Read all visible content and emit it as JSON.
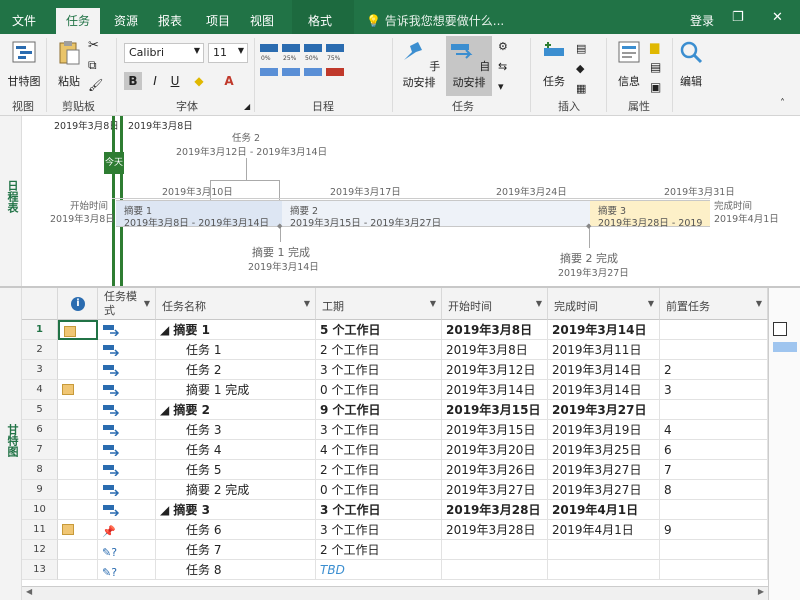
{
  "menu": {
    "tabs": [
      {
        "label": "文件"
      },
      {
        "label": "任务"
      },
      {
        "label": "资源"
      },
      {
        "label": "报表"
      },
      {
        "label": "项目"
      },
      {
        "label": "视图"
      },
      {
        "label": "格式"
      }
    ],
    "tell_me": "告诉我您想要做什么...",
    "login": "登录"
  },
  "ribbon": {
    "view": {
      "gantt_label": "甘特图",
      "group": "视图"
    },
    "clipboard": {
      "paste_label": "粘贴",
      "group": "剪贴板"
    },
    "font": {
      "name": "Calibri",
      "size": "11",
      "bold": "B",
      "italic": "I",
      "underline": "U",
      "group": "字体"
    },
    "schedule": {
      "group": "日程"
    },
    "tasks": {
      "manual_label": "手动安排",
      "auto_label": "自动安排",
      "task_label": "任务",
      "group": "任务"
    },
    "insert": {
      "group": "插入"
    },
    "properties": {
      "info_label": "信息",
      "group": "属性"
    },
    "editing": {
      "label": "编辑"
    }
  },
  "timeline": {
    "side_label": "日程表",
    "today_top_left": "2019年3月8日",
    "today_top_right": "2019年3月8日",
    "today_label": "今天",
    "task2_label": "任务 2",
    "task2_dates": "2019年3月12日 - 2019年3月14日",
    "scale": [
      "2019年3月10日",
      "2019年3月17日",
      "2019年3月24日",
      "2019年3月31日"
    ],
    "start_label": "开始时间",
    "start_date": "2019年3月8日",
    "finish_label": "完成时间",
    "finish_date": "2019年4月1日",
    "bars": [
      {
        "name": "摘要 1",
        "dates": "2019年3月8日 - 2019年3月14日",
        "color": "#dde6f3"
      },
      {
        "name": "摘要 2",
        "dates": "2019年3月15日 - 2019年3月27日",
        "color": "#eef2f8"
      },
      {
        "name": "摘要 3",
        "dates": "2019年3月28日 - 2019",
        "color": "#fdf0c8"
      }
    ],
    "milestones": [
      {
        "name": "摘要 1 完成",
        "date": "2019年3月14日"
      },
      {
        "name": "摘要 2 完成",
        "date": "2019年3月27日"
      }
    ]
  },
  "gantt": {
    "side_label": "甘特图",
    "headers": {
      "info": "i",
      "mode": "任务模式",
      "name": "任务名称",
      "duration": "工期",
      "start": "开始时间",
      "finish": "完成时间",
      "pred": "前置任务"
    },
    "rows": [
      {
        "id": "1",
        "name": "◢ 摘要 1",
        "duration": "5 个工作日",
        "start": "2019年3月8日",
        "finish": "2019年3月14日",
        "pred": "",
        "summary": true,
        "note": true,
        "mode": "auto",
        "indent": 0
      },
      {
        "id": "2",
        "name": "任务 1",
        "duration": "2 个工作日",
        "start": "2019年3月8日",
        "finish": "2019年3月11日",
        "pred": "",
        "summary": false,
        "note": false,
        "mode": "auto",
        "indent": 1
      },
      {
        "id": "3",
        "name": "任务 2",
        "duration": "3 个工作日",
        "start": "2019年3月12日",
        "finish": "2019年3月14日",
        "pred": "2",
        "summary": false,
        "note": false,
        "mode": "auto",
        "indent": 1
      },
      {
        "id": "4",
        "name": "摘要 1 完成",
        "duration": "0 个工作日",
        "start": "2019年3月14日",
        "finish": "2019年3月14日",
        "pred": "3",
        "summary": false,
        "note": true,
        "mode": "auto",
        "indent": 1
      },
      {
        "id": "5",
        "name": "◢ 摘要 2",
        "duration": "9 个工作日",
        "start": "2019年3月15日",
        "finish": "2019年3月27日",
        "pred": "",
        "summary": true,
        "note": false,
        "mode": "auto",
        "indent": 0
      },
      {
        "id": "6",
        "name": "任务 3",
        "duration": "3 个工作日",
        "start": "2019年3月15日",
        "finish": "2019年3月19日",
        "pred": "4",
        "summary": false,
        "note": false,
        "mode": "auto",
        "indent": 1
      },
      {
        "id": "7",
        "name": "任务 4",
        "duration": "4 个工作日",
        "start": "2019年3月20日",
        "finish": "2019年3月25日",
        "pred": "6",
        "summary": false,
        "note": false,
        "mode": "auto",
        "indent": 1
      },
      {
        "id": "8",
        "name": "任务 5",
        "duration": "2 个工作日",
        "start": "2019年3月26日",
        "finish": "2019年3月27日",
        "pred": "7",
        "summary": false,
        "note": false,
        "mode": "auto",
        "indent": 1
      },
      {
        "id": "9",
        "name": "摘要 2 完成",
        "duration": "0 个工作日",
        "start": "2019年3月27日",
        "finish": "2019年3月27日",
        "pred": "8",
        "summary": false,
        "note": false,
        "mode": "auto",
        "indent": 1
      },
      {
        "id": "10",
        "name": "◢ 摘要 3",
        "duration": "3 个工作日",
        "start": "2019年3月28日",
        "finish": "2019年4月1日",
        "pred": "",
        "summary": true,
        "note": false,
        "mode": "auto",
        "indent": 0
      },
      {
        "id": "11",
        "name": "任务 6",
        "duration": "3 个工作日",
        "start": "2019年3月28日",
        "finish": "2019年4月1日",
        "pred": "9",
        "summary": false,
        "note": true,
        "mode": "manual",
        "indent": 1
      },
      {
        "id": "12",
        "name": "任务 7",
        "duration": "2 个工作日",
        "start": "",
        "finish": "",
        "pred": "",
        "summary": false,
        "note": false,
        "mode": "manual-q",
        "indent": 1
      },
      {
        "id": "13",
        "name": "任务 8",
        "duration": "TBD",
        "start": "",
        "finish": "",
        "pred": "",
        "summary": false,
        "note": false,
        "mode": "manual-q",
        "indent": 1
      }
    ]
  },
  "colors": {
    "brand": "#217346",
    "today": "#2e7d32",
    "selection": "#217346"
  }
}
